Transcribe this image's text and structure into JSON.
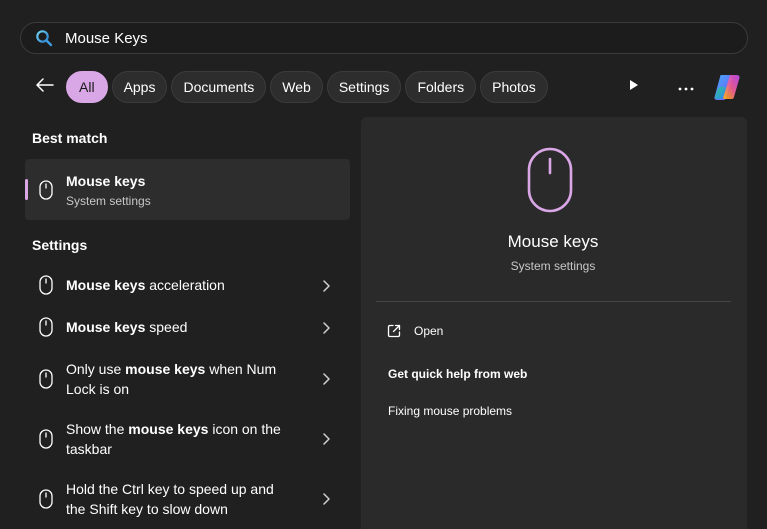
{
  "search": {
    "value": "Mouse Keys"
  },
  "filters": {
    "items": [
      "All",
      "Apps",
      "Documents",
      "Web",
      "Settings",
      "Folders",
      "Photos"
    ],
    "active": "All"
  },
  "left": {
    "best_match_label": "Best match",
    "best": {
      "title": "Mouse keys",
      "subtitle": "System settings"
    },
    "settings_label": "Settings",
    "results": [
      {
        "pre": "",
        "bold": "Mouse keys",
        "post": " acceleration"
      },
      {
        "pre": "",
        "bold": "Mouse keys",
        "post": " speed"
      },
      {
        "pre": "Only use ",
        "bold": "mouse keys",
        "post": " when Num Lock is on"
      },
      {
        "pre": "Show the ",
        "bold": "mouse keys",
        "post": " icon on the taskbar"
      },
      {
        "pre": "Hold the Ctrl key to speed up and the Shift key to slow down",
        "bold": "",
        "post": ""
      }
    ]
  },
  "right": {
    "title": "Mouse keys",
    "subtitle": "System settings",
    "open_label": "Open",
    "help_heading": "Get quick help from web",
    "help_link": "Fixing mouse problems"
  },
  "colors": {
    "accent": "#d9a7e6",
    "background": "#202020",
    "panel": "#2a2a2a"
  },
  "icons": [
    "search-icon",
    "back-arrow-icon",
    "play-icon",
    "more-icon",
    "copilot-icon",
    "mouse-icon",
    "chevron-right-icon",
    "open-external-icon"
  ]
}
